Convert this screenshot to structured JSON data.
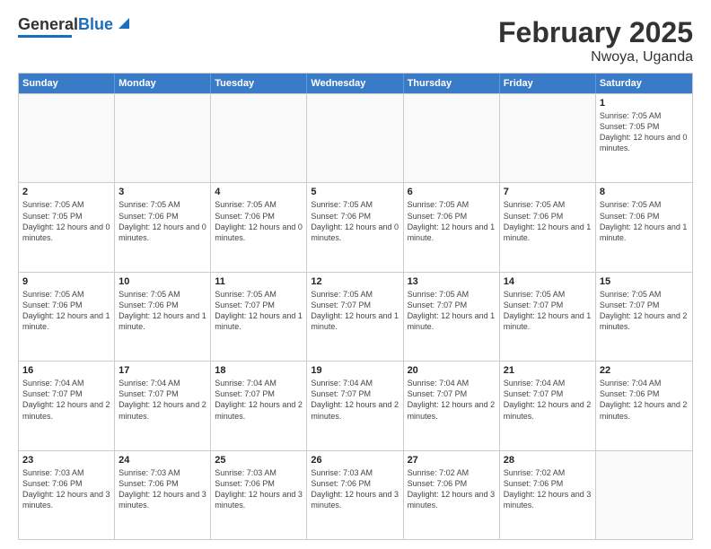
{
  "header": {
    "logo_line1": "General",
    "logo_line2": "Blue",
    "main_title": "February 2025",
    "subtitle": "Nwoya, Uganda"
  },
  "days_of_week": [
    "Sunday",
    "Monday",
    "Tuesday",
    "Wednesday",
    "Thursday",
    "Friday",
    "Saturday"
  ],
  "weeks": [
    [
      {
        "day": "",
        "empty": true
      },
      {
        "day": "",
        "empty": true
      },
      {
        "day": "",
        "empty": true
      },
      {
        "day": "",
        "empty": true
      },
      {
        "day": "",
        "empty": true
      },
      {
        "day": "",
        "empty": true
      },
      {
        "day": "1",
        "sunrise": "Sunrise: 7:05 AM",
        "sunset": "Sunset: 7:05 PM",
        "daylight": "Daylight: 12 hours and 0 minutes."
      }
    ],
    [
      {
        "day": "2",
        "sunrise": "Sunrise: 7:05 AM",
        "sunset": "Sunset: 7:05 PM",
        "daylight": "Daylight: 12 hours and 0 minutes."
      },
      {
        "day": "3",
        "sunrise": "Sunrise: 7:05 AM",
        "sunset": "Sunset: 7:06 PM",
        "daylight": "Daylight: 12 hours and 0 minutes."
      },
      {
        "day": "4",
        "sunrise": "Sunrise: 7:05 AM",
        "sunset": "Sunset: 7:06 PM",
        "daylight": "Daylight: 12 hours and 0 minutes."
      },
      {
        "day": "5",
        "sunrise": "Sunrise: 7:05 AM",
        "sunset": "Sunset: 7:06 PM",
        "daylight": "Daylight: 12 hours and 0 minutes."
      },
      {
        "day": "6",
        "sunrise": "Sunrise: 7:05 AM",
        "sunset": "Sunset: 7:06 PM",
        "daylight": "Daylight: 12 hours and 1 minute."
      },
      {
        "day": "7",
        "sunrise": "Sunrise: 7:05 AM",
        "sunset": "Sunset: 7:06 PM",
        "daylight": "Daylight: 12 hours and 1 minute."
      },
      {
        "day": "8",
        "sunrise": "Sunrise: 7:05 AM",
        "sunset": "Sunset: 7:06 PM",
        "daylight": "Daylight: 12 hours and 1 minute."
      }
    ],
    [
      {
        "day": "9",
        "sunrise": "Sunrise: 7:05 AM",
        "sunset": "Sunset: 7:06 PM",
        "daylight": "Daylight: 12 hours and 1 minute."
      },
      {
        "day": "10",
        "sunrise": "Sunrise: 7:05 AM",
        "sunset": "Sunset: 7:06 PM",
        "daylight": "Daylight: 12 hours and 1 minute."
      },
      {
        "day": "11",
        "sunrise": "Sunrise: 7:05 AM",
        "sunset": "Sunset: 7:07 PM",
        "daylight": "Daylight: 12 hours and 1 minute."
      },
      {
        "day": "12",
        "sunrise": "Sunrise: 7:05 AM",
        "sunset": "Sunset: 7:07 PM",
        "daylight": "Daylight: 12 hours and 1 minute."
      },
      {
        "day": "13",
        "sunrise": "Sunrise: 7:05 AM",
        "sunset": "Sunset: 7:07 PM",
        "daylight": "Daylight: 12 hours and 1 minute."
      },
      {
        "day": "14",
        "sunrise": "Sunrise: 7:05 AM",
        "sunset": "Sunset: 7:07 PM",
        "daylight": "Daylight: 12 hours and 1 minute."
      },
      {
        "day": "15",
        "sunrise": "Sunrise: 7:05 AM",
        "sunset": "Sunset: 7:07 PM",
        "daylight": "Daylight: 12 hours and 2 minutes."
      }
    ],
    [
      {
        "day": "16",
        "sunrise": "Sunrise: 7:04 AM",
        "sunset": "Sunset: 7:07 PM",
        "daylight": "Daylight: 12 hours and 2 minutes."
      },
      {
        "day": "17",
        "sunrise": "Sunrise: 7:04 AM",
        "sunset": "Sunset: 7:07 PM",
        "daylight": "Daylight: 12 hours and 2 minutes."
      },
      {
        "day": "18",
        "sunrise": "Sunrise: 7:04 AM",
        "sunset": "Sunset: 7:07 PM",
        "daylight": "Daylight: 12 hours and 2 minutes."
      },
      {
        "day": "19",
        "sunrise": "Sunrise: 7:04 AM",
        "sunset": "Sunset: 7:07 PM",
        "daylight": "Daylight: 12 hours and 2 minutes."
      },
      {
        "day": "20",
        "sunrise": "Sunrise: 7:04 AM",
        "sunset": "Sunset: 7:07 PM",
        "daylight": "Daylight: 12 hours and 2 minutes."
      },
      {
        "day": "21",
        "sunrise": "Sunrise: 7:04 AM",
        "sunset": "Sunset: 7:07 PM",
        "daylight": "Daylight: 12 hours and 2 minutes."
      },
      {
        "day": "22",
        "sunrise": "Sunrise: 7:04 AM",
        "sunset": "Sunset: 7:06 PM",
        "daylight": "Daylight: 12 hours and 2 minutes."
      }
    ],
    [
      {
        "day": "23",
        "sunrise": "Sunrise: 7:03 AM",
        "sunset": "Sunset: 7:06 PM",
        "daylight": "Daylight: 12 hours and 3 minutes."
      },
      {
        "day": "24",
        "sunrise": "Sunrise: 7:03 AM",
        "sunset": "Sunset: 7:06 PM",
        "daylight": "Daylight: 12 hours and 3 minutes."
      },
      {
        "day": "25",
        "sunrise": "Sunrise: 7:03 AM",
        "sunset": "Sunset: 7:06 PM",
        "daylight": "Daylight: 12 hours and 3 minutes."
      },
      {
        "day": "26",
        "sunrise": "Sunrise: 7:03 AM",
        "sunset": "Sunset: 7:06 PM",
        "daylight": "Daylight: 12 hours and 3 minutes."
      },
      {
        "day": "27",
        "sunrise": "Sunrise: 7:02 AM",
        "sunset": "Sunset: 7:06 PM",
        "daylight": "Daylight: 12 hours and 3 minutes."
      },
      {
        "day": "28",
        "sunrise": "Sunrise: 7:02 AM",
        "sunset": "Sunset: 7:06 PM",
        "daylight": "Daylight: 12 hours and 3 minutes."
      },
      {
        "day": "",
        "empty": true
      }
    ]
  ]
}
